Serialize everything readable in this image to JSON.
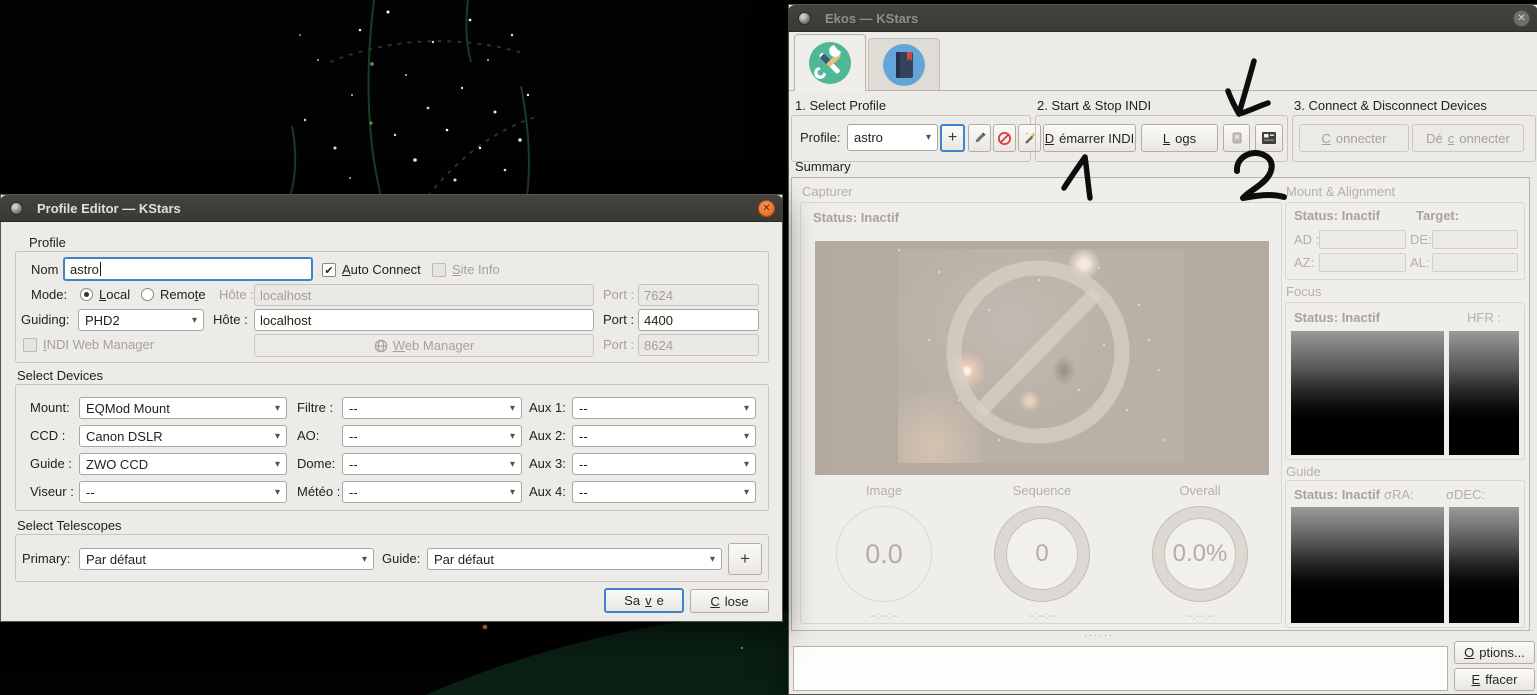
{
  "colors": {
    "accent_blue": "#3f83c9",
    "titlebar": "#3a3935",
    "close_button_orange": "#ee6f27",
    "tab_setup_teal": "#52b796",
    "tab_scheduler_blue": "#63a5d8",
    "delete_red": "#d4403a",
    "sky_grid_green": "#1c3a28",
    "window_bg": "#edebe7"
  },
  "icons": {
    "dropdown": "▾",
    "check": "✔",
    "plus": "+",
    "close": "✕"
  },
  "ekos": {
    "title": "Ekos — KStars",
    "sections": [
      "1. Select Profile",
      "2. Start & Stop INDI",
      "3. Connect & Disconnect Devices"
    ],
    "profile_label": "Profile:",
    "profile_value": "astro",
    "buttons": {
      "start_indi": {
        "label": "Démarrer INDI",
        "mnemonic": "D"
      },
      "logs": {
        "label": "Logs",
        "mnemonic": "L"
      },
      "connect": {
        "label": "Connecter",
        "mnemonic": "C"
      },
      "disconnect": {
        "label": "Déconnecter",
        "mnemonic": "c"
      }
    },
    "summary_label": "Summary",
    "capture": {
      "title": "Capturer",
      "status_label": "Status:",
      "status_value": "Inactif",
      "progress": [
        {
          "label": "Image",
          "value": "0.0",
          "time": "--:--:--"
        },
        {
          "label": "Sequence",
          "value": "0",
          "time": "--:--:--"
        },
        {
          "label": "Overall",
          "value": "0.0%",
          "time": "--:--:--"
        }
      ]
    },
    "mount": {
      "title": "Mount & Alignment",
      "status_label": "Status:",
      "status_value": "Inactif",
      "target_label": "Target:",
      "ad_label": "AD :",
      "de_label": "DE:",
      "az_label": "AZ:",
      "al_label": "AL:"
    },
    "focus": {
      "title": "Focus",
      "status_label": "Status:",
      "status_value": "Inactif",
      "hfr_label": "HFR :"
    },
    "guide": {
      "title": "Guide",
      "status_label": "Status:",
      "status_value": "Inactif",
      "sigma_ra_label": "σRA:",
      "sigma_dec_label": "σDEC:"
    },
    "footer": {
      "options": {
        "label": "Options...",
        "mnemonic": "O"
      },
      "clear": {
        "label": "Effacer",
        "mnemonic": "E"
      }
    }
  },
  "profile_editor": {
    "title": "Profile Editor — KStars",
    "sections": {
      "profile": "Profile",
      "devices": "Select Devices",
      "telescopes": "Select Telescopes"
    },
    "fields": {
      "nom_label": "Nom :",
      "nom_value": "astro",
      "auto_connect": {
        "label": "Auto Connect",
        "mnemonic": "A"
      },
      "site_info": {
        "label": "Site Info",
        "mnemonic": "S"
      },
      "mode_label": "Mode:",
      "local": {
        "label": "Local",
        "mnemonic": "L"
      },
      "remote": {
        "label": "Remote",
        "mnemonic": "t"
      },
      "mode_host_label": "Hôte :",
      "mode_host_placeholder": "localhost",
      "mode_port_label": "Port :",
      "mode_port_placeholder": "7624",
      "guiding_label": "Guiding:",
      "guiding_value": "PHD2",
      "guide_host_label": "Hôte :",
      "guide_host_value": "localhost",
      "guide_port_label": "Port :",
      "guide_port_value": "4400",
      "indi_web": {
        "label": "INDI Web Manager",
        "mnemonic": "I"
      },
      "web_manager_btn": {
        "label": "Web Manager",
        "mnemonic": "W"
      },
      "web_port_label": "Port :",
      "web_port_placeholder": "8624"
    },
    "devices": [
      {
        "label": "Mount:",
        "value": "EQMod Mount"
      },
      {
        "label": "Filtre :",
        "value": "--"
      },
      {
        "label": "Aux 1:",
        "value": "--"
      },
      {
        "label": "CCD :",
        "value": "Canon DSLR"
      },
      {
        "label": "AO:",
        "value": "--"
      },
      {
        "label": "Aux 2:",
        "value": "--"
      },
      {
        "label": "Guide :",
        "value": "ZWO CCD"
      },
      {
        "label": "Dome:",
        "value": "--"
      },
      {
        "label": "Aux 3:",
        "value": "--"
      },
      {
        "label": "Viseur :",
        "value": "--"
      },
      {
        "label": "Météo :",
        "value": "--"
      },
      {
        "label": "Aux 4:",
        "value": "--"
      }
    ],
    "telescopes": {
      "primary_label": "Primary:",
      "primary_value": "Par défaut",
      "guide_label": "Guide:",
      "guide_value": "Par défaut"
    },
    "buttons": {
      "save": {
        "label": "Save",
        "mnemonic": "v"
      },
      "close": {
        "label": "Close",
        "mnemonic": "C"
      }
    }
  },
  "annotations": {
    "step_1": "1",
    "step_2": "2",
    "arrow": "hand-drawn check arrow"
  }
}
